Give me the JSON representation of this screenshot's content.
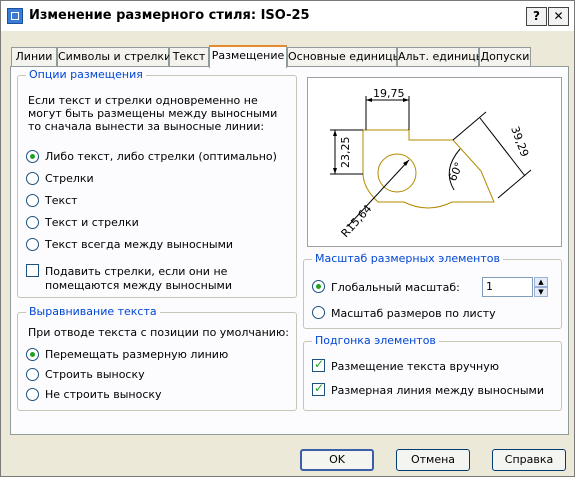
{
  "window": {
    "title": "Изменение размерного стиля: ISO-25",
    "help_label": "?",
    "close_label": "✕"
  },
  "tabs": [
    {
      "label": "Линии"
    },
    {
      "label": "Символы и стрелки"
    },
    {
      "label": "Текст"
    },
    {
      "label": "Размещение",
      "active": true
    },
    {
      "label": "Основные единицы"
    },
    {
      "label": "Альт. единицы"
    },
    {
      "label": "Допуски"
    }
  ],
  "fit_options": {
    "title": "Опции размещения",
    "description": [
      "Если текст и стрелки одновременно не",
      "могут быть размещены между выносными",
      "то сначала вынести за выносные линии:"
    ],
    "options": [
      {
        "label": "Либо текст, либо стрелки (оптимально)",
        "selected": true
      },
      {
        "label": "Стрелки",
        "selected": false
      },
      {
        "label": "Текст",
        "selected": false
      },
      {
        "label": "Текст и стрелки",
        "selected": false
      },
      {
        "label": "Текст всегда между выносными",
        "selected": false
      }
    ],
    "suppress_label_line1": "Подавить стрелки, если они не",
    "suppress_label_line2": "помещаются между выносными",
    "suppress_checked": false
  },
  "text_placement": {
    "title": "Выравнивание текста",
    "description": "При отводе текста с позиции по умолчанию:",
    "options": [
      {
        "label": "Перемещать размерную линию",
        "selected": true
      },
      {
        "label": "Строить выноску",
        "selected": false
      },
      {
        "label": "Не строить выноску",
        "selected": false
      }
    ]
  },
  "preview": {
    "labels": {
      "top": "19,75",
      "left": "23,25",
      "right": "39,29",
      "angle": "60°",
      "radius": "R15,64"
    },
    "colors": {
      "geometry": "#b38a00",
      "dims": "#000000",
      "background": "#ffffff"
    }
  },
  "scale": {
    "title": "Масштаб размерных элементов",
    "global_label": "Глобальный масштаб:",
    "global_selected": true,
    "global_value": "1",
    "layout_label": "Масштаб размеров по листу",
    "layout_selected": false
  },
  "fine_tuning": {
    "title": "Подгонка элементов",
    "manual_label": "Размещение текста вручную",
    "manual_checked": true,
    "dimline_label": "Размерная линия между выносными",
    "dimline_checked": true
  },
  "buttons": {
    "ok": "OK",
    "cancel": "Отмена",
    "help": "Справка"
  },
  "colors": {
    "group_title": "#0046d5",
    "active_tab_accent": "#e68b2c",
    "radio_dot": "#21a121"
  }
}
